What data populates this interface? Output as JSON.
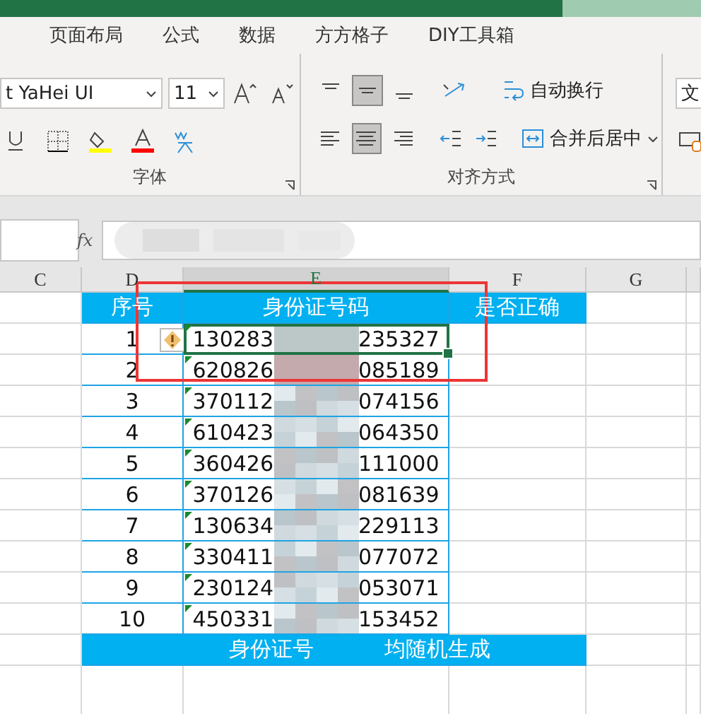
{
  "tabs": [
    {
      "label": "页面布局"
    },
    {
      "label": "公式"
    },
    {
      "label": "数据"
    },
    {
      "label": "方方格子"
    },
    {
      "label": "DIY工具箱"
    }
  ],
  "ribbon": {
    "font_name": "t YaHei UI",
    "font_size": "11",
    "font_group": "字体",
    "align_group": "对齐方式",
    "vertical_align": [
      {
        "selected": false
      },
      {
        "selected": true
      },
      {
        "selected": false
      }
    ],
    "horizontal_align": [
      {
        "selected": false
      },
      {
        "selected": true
      },
      {
        "selected": false
      }
    ],
    "wrap_text": "自动换行",
    "merge_center": "合并后居中",
    "number_format": "文"
  },
  "formula_bar": {
    "fx": "fx"
  },
  "columns": [
    {
      "label": "C",
      "selected": false
    },
    {
      "label": "D",
      "selected": false
    },
    {
      "label": "E",
      "selected": true
    },
    {
      "label": "F",
      "selected": false
    },
    {
      "label": "G",
      "selected": false
    }
  ],
  "table": {
    "header": [
      "序号",
      "身份证号码",
      "是否正确"
    ],
    "rows": [
      {
        "no": "1",
        "id_start": "130283",
        "id_end": "235327",
        "selected": true,
        "warning": true
      },
      {
        "no": "2",
        "id_start": "620826",
        "id_end": "085189",
        "selected": false,
        "warning": false
      },
      {
        "no": "3",
        "id_start": "370112",
        "id_end": "074156",
        "selected": false,
        "warning": false
      },
      {
        "no": "4",
        "id_start": "610423",
        "id_end": "064350",
        "selected": false,
        "warning": false
      },
      {
        "no": "5",
        "id_start": "360426",
        "id_end": "111000",
        "selected": false,
        "warning": false
      },
      {
        "no": "6",
        "id_start": "370126",
        "id_end": "081639",
        "selected": false,
        "warning": false
      },
      {
        "no": "7",
        "id_start": "130634",
        "id_end": "229113",
        "selected": false,
        "warning": false
      },
      {
        "no": "8",
        "id_start": "330411",
        "id_end": "077072",
        "selected": false,
        "warning": false
      },
      {
        "no": "9",
        "id_start": "230124",
        "id_end": "053071",
        "selected": false,
        "warning": false
      },
      {
        "no": "10",
        "id_start": "450331",
        "id_end": "153452",
        "selected": false,
        "warning": false
      }
    ],
    "footer": [
      "身份证号",
      "均随机生成"
    ]
  }
}
